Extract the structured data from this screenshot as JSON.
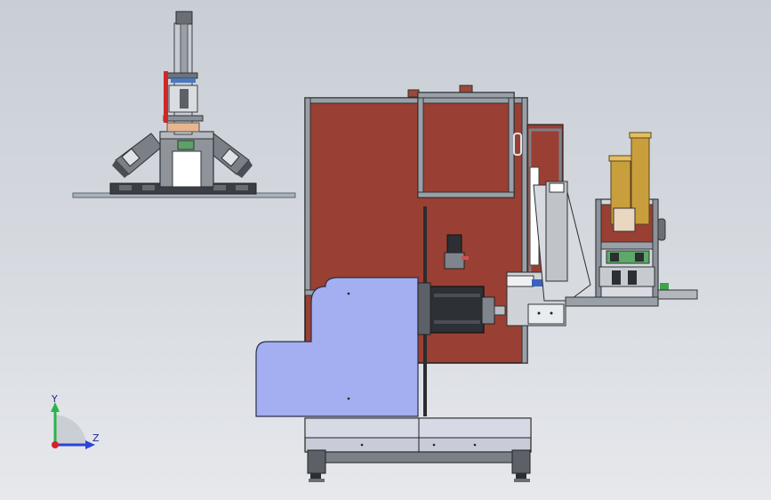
{
  "viewport": {
    "background_top": "#c9ced6",
    "background_bottom": "#e6e8ec"
  },
  "triad": {
    "y_label": "Y",
    "z_label": "Z",
    "y_color": "#2bb34a",
    "z_color": "#2a44d8",
    "origin_color": "#d8202a"
  },
  "colors": {
    "panel_red": "#9a3f33",
    "frame_gray": "#8c929b",
    "cover_blue": "#a2aef0",
    "brass": "#c8a040",
    "steel": "#b3b8c0",
    "dark": "#2b2e33",
    "green": "#4a9a5a"
  }
}
